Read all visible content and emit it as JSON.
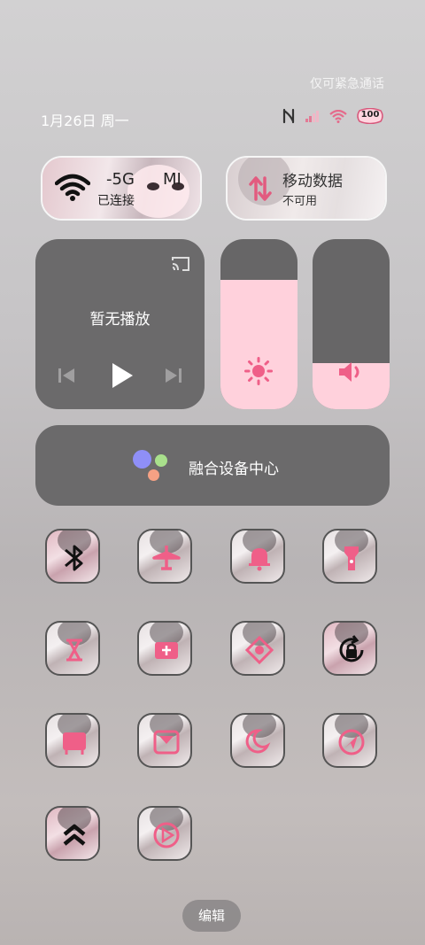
{
  "header": {
    "emergency_text": "仅可紧急通话",
    "date_text": "1月26日 周一",
    "status_icons": [
      "nfc-icon",
      "signal-icon",
      "wifi-icon",
      "battery-icon"
    ],
    "battery_text": "100"
  },
  "wifi_tile": {
    "title": "-5G",
    "title_overlay": "MI",
    "status": "已连接",
    "icon": "wifi-icon"
  },
  "mobile_tile": {
    "title": "移动数据",
    "status": "不可用",
    "icon": "data-arrows-icon"
  },
  "media": {
    "title": "暂无播放",
    "icons": [
      "cast-icon",
      "previous-icon",
      "play-icon",
      "next-icon"
    ]
  },
  "brightness": {
    "level": 0.76,
    "icon": "brightness-icon"
  },
  "volume": {
    "level": 0.27,
    "icon": "volume-icon"
  },
  "device_center": {
    "label": "融合设备中心",
    "icon": "device-center-icon"
  },
  "toggles": [
    {
      "name": "bluetooth",
      "icon": "bluetooth-icon",
      "active": true
    },
    {
      "name": "airplane",
      "icon": "airplane-icon",
      "active": false
    },
    {
      "name": "silent",
      "icon": "bell-icon",
      "active": false
    },
    {
      "name": "flashlight",
      "icon": "flashlight-icon",
      "active": false
    },
    {
      "name": "hotspot",
      "icon": "hotspot-icon",
      "active": false
    },
    {
      "name": "screenshot",
      "icon": "screenshot-icon",
      "active": false
    },
    {
      "name": "screen-recorder",
      "icon": "recorder-icon",
      "active": false
    },
    {
      "name": "rotation-lock",
      "icon": "rotation-lock-icon",
      "active": true
    },
    {
      "name": "screen-cast",
      "icon": "cast-screen-icon",
      "active": false
    },
    {
      "name": "reading-mode",
      "icon": "reading-icon",
      "active": false
    },
    {
      "name": "dark-mode",
      "icon": "moon-icon",
      "active": false
    },
    {
      "name": "location",
      "icon": "location-icon",
      "active": false
    },
    {
      "name": "performance",
      "icon": "chevrons-up-icon",
      "active": true
    },
    {
      "name": "video-toolbox",
      "icon": "play-circle-icon",
      "active": false
    }
  ],
  "edit_button": {
    "label": "编辑"
  },
  "colors": {
    "accent": "#ffd1dc",
    "accent_icon": "#ef5f88",
    "panel": "#6b6a6b"
  }
}
